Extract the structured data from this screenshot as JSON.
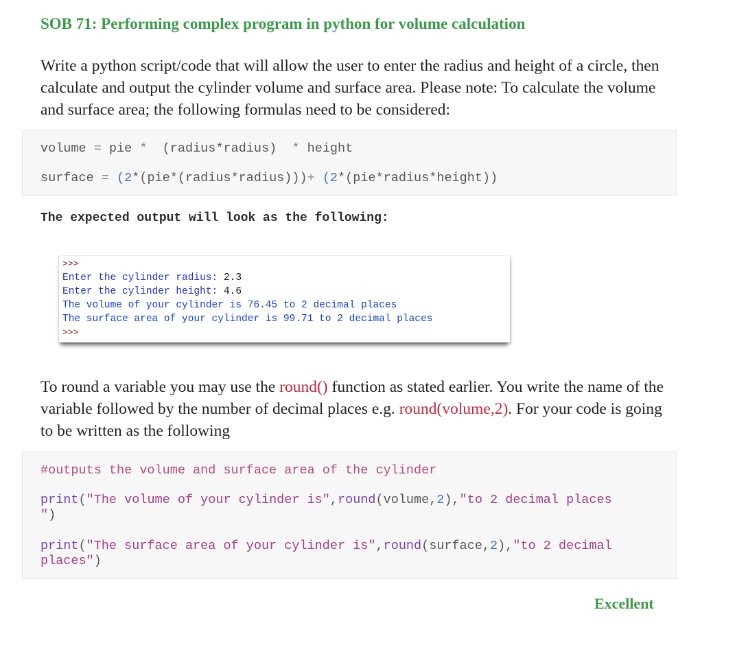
{
  "title": "SOB 71: Performing complex program in python for volume calculation",
  "intro": "Write a python script/code that will allow the user to enter the radius and height of a circle, then calculate and output the cylinder volume and surface area. Please note: To calculate the volume and surface area; the following formulas need to be considered:",
  "formulas": {
    "volume": {
      "lhs": "volume",
      "eq": " = ",
      "rhs_a": "pie ",
      "op1": "*",
      "rhs_b": "  (radius*radius)  ",
      "op2": "*",
      "rhs_c": " height"
    },
    "surface": {
      "lhs": "surface",
      "eq": " = ",
      "num1": "(2",
      "part_a": "*(pie*(radius*radius)))",
      "plus": "+ ",
      "num2": "(2",
      "part_b": "*(pie*radius*height))"
    }
  },
  "expected_heading": "The expected output will look as the following:",
  "shell": {
    "prompt1": ">>>",
    "line1_label": "Enter the cylinder radius: ",
    "line1_value": "2.3",
    "line2_label": "Enter the cylinder height: ",
    "line2_value": "4.6",
    "line3": "The volume of your cylinder is 76.45 to 2 decimal places",
    "line4": "The surface area of your cylinder is 99.71 to 2 decimal places",
    "prompt2": ">>>"
  },
  "round_para": {
    "t1": "To round a variable you may use the ",
    "fn1": "round()",
    "t2": " function as stated earlier. You write the name of the variable followed by the number of decimal places e.g. ",
    "fn2": "round(volume,2)",
    "t3": ". For your code is going to be written as the following"
  },
  "code2": {
    "comment": "#outputs the volume and surface area of the cylinder",
    "print1": {
      "kw": "print",
      "open": "(",
      "str1": "\"The volume of your cylinder is\"",
      "mid": ",",
      "fn": "round",
      "args": "(volume,",
      "num": "2",
      "close_arg": "),",
      "str2a": "\"to 2 decimal places",
      "str2b": "\"",
      "end": ")"
    },
    "print2": {
      "kw": "print",
      "open": "(",
      "str1": "\"The surface area of your cylinder is\"",
      "mid": ",",
      "fn": "round",
      "args": "(surface,",
      "num": "2",
      "close_arg": "),",
      "str2a": "\"to 2 decimal",
      "str2b": "places\"",
      "end": ")"
    }
  },
  "grade": "Excellent",
  "colors": {
    "title": "#3c9b4a",
    "highlight": "#c0283a",
    "shell_text": "#1144cc"
  }
}
